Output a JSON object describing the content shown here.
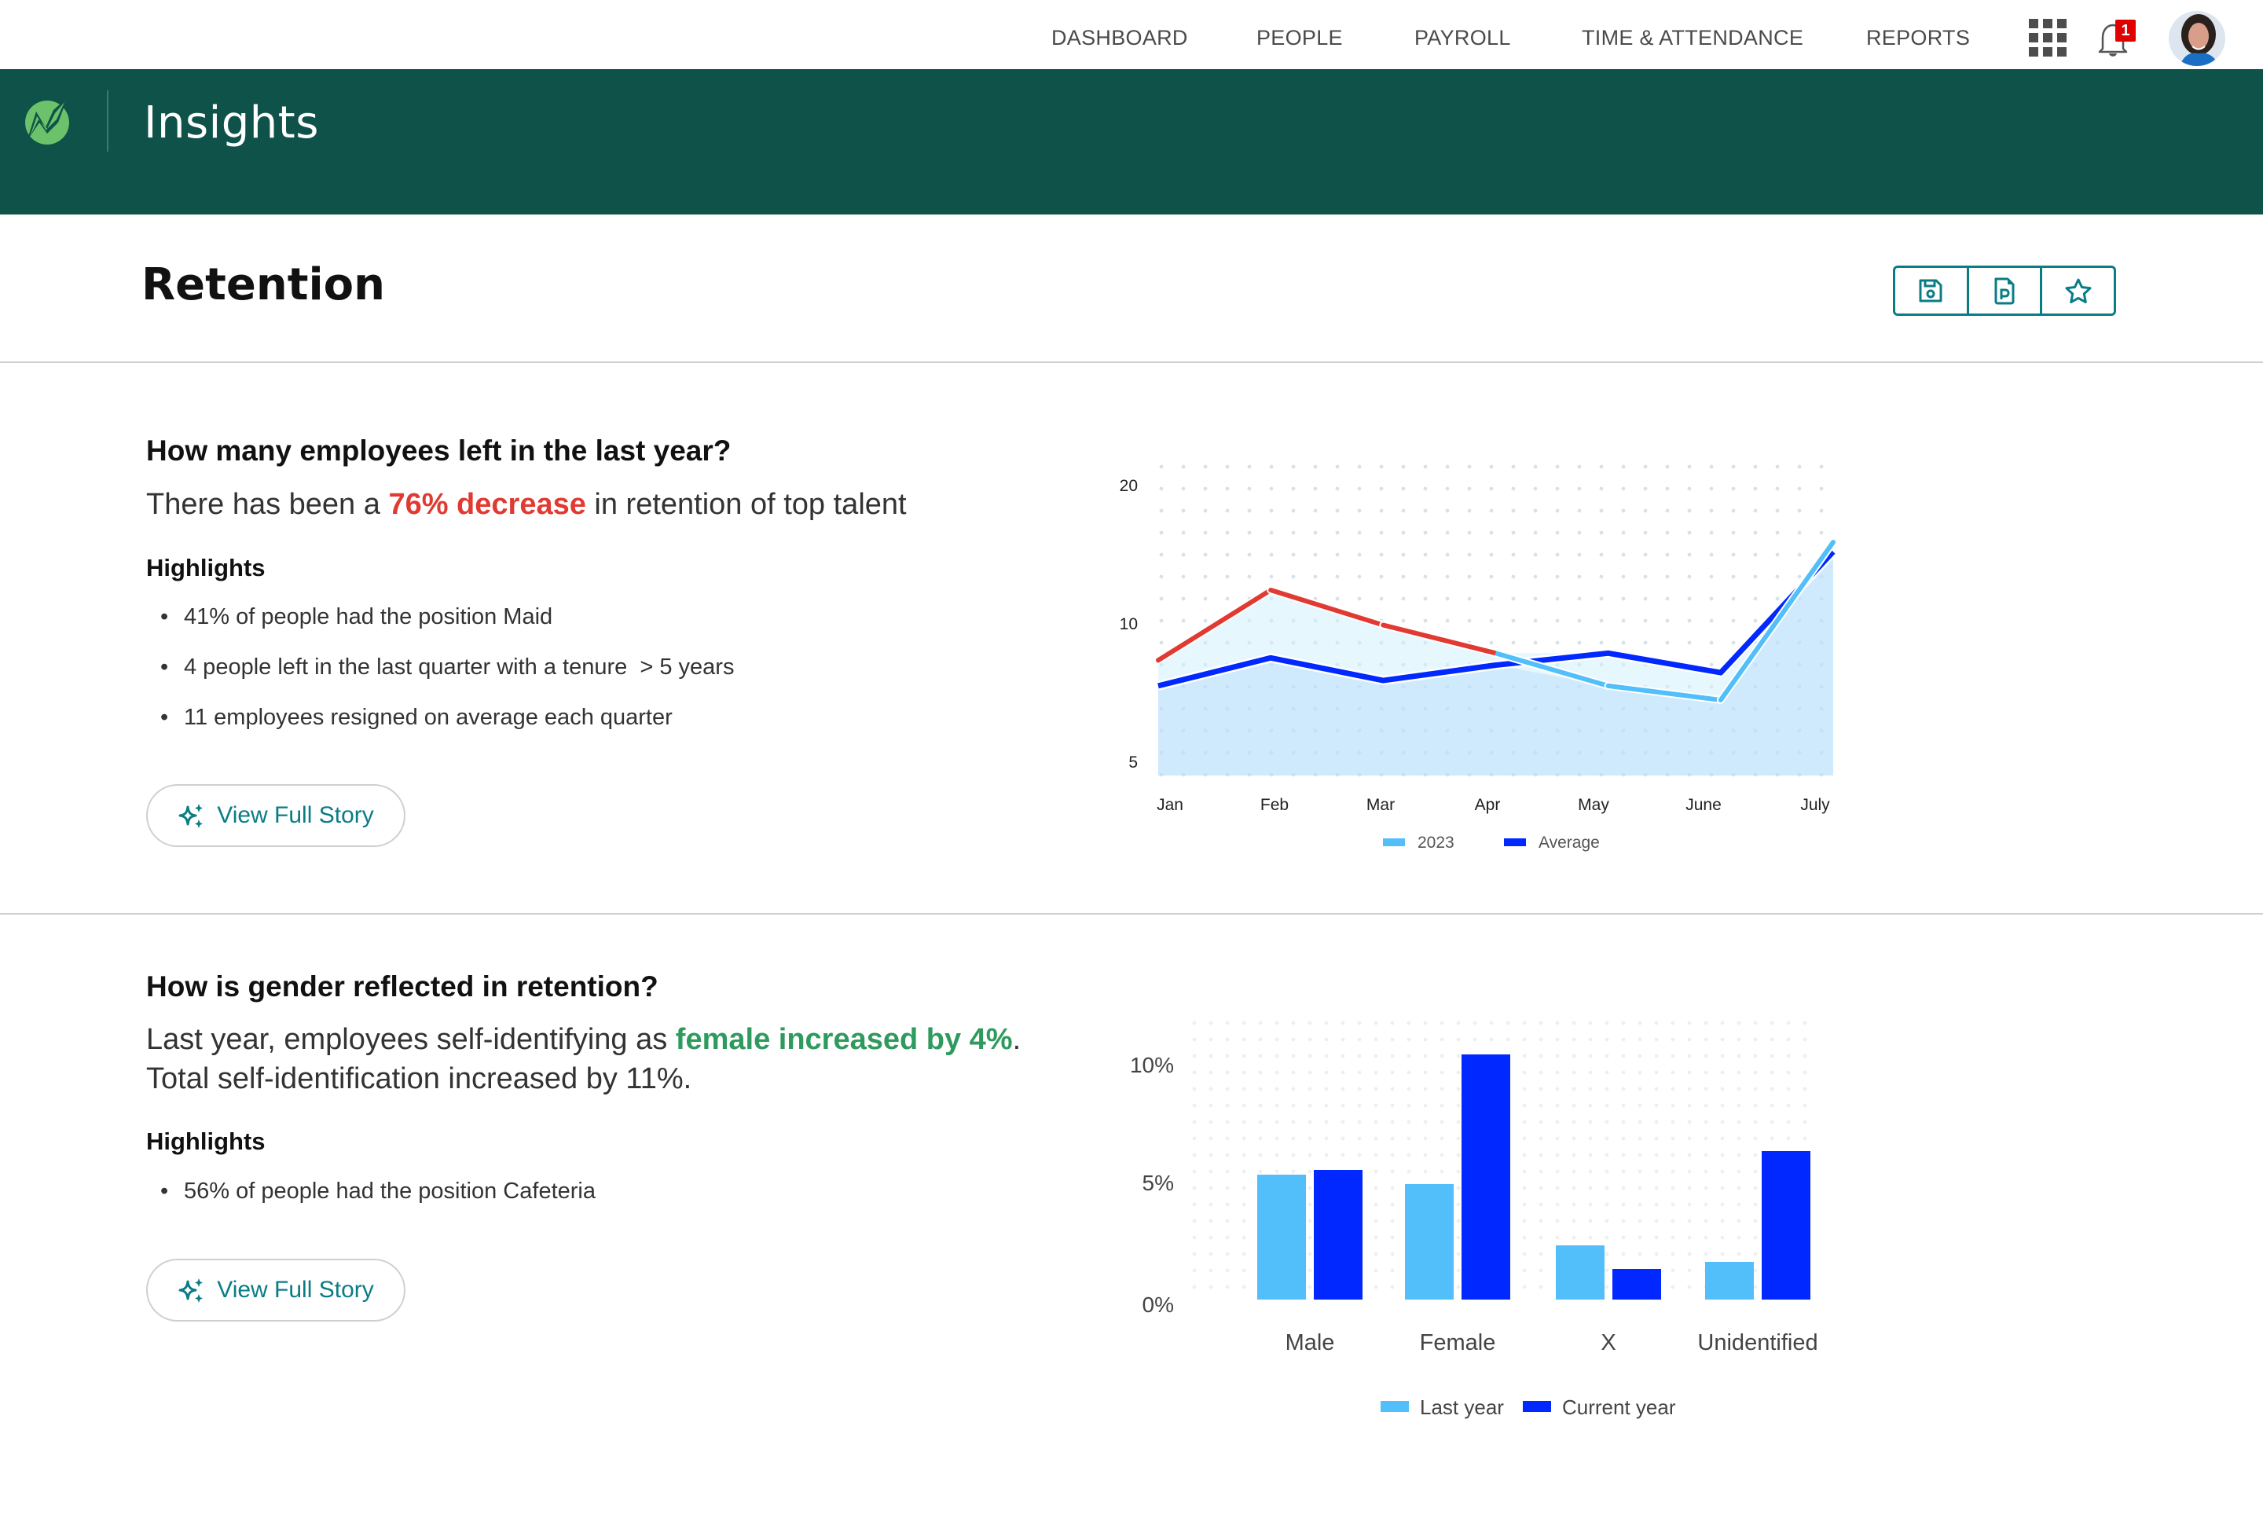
{
  "topnav": {
    "items": [
      "DASHBOARD",
      "PEOPLE",
      "PAYROLL",
      "TIME & ATTENDANCE",
      "REPORTS"
    ],
    "notification_count": "1",
    "icons": {
      "apps": "apps-grid-icon",
      "notifications": "bell-icon",
      "profile": "avatar"
    }
  },
  "banner": {
    "title": "Insights",
    "logo": "brand-logo"
  },
  "page": {
    "title": "Retention",
    "actions": [
      {
        "name": "save",
        "icon": "save-icon"
      },
      {
        "name": "export-pdf",
        "icon": "pdf-file-icon"
      },
      {
        "name": "favorite",
        "icon": "star-icon"
      }
    ]
  },
  "colors": {
    "banner": "#0e5249",
    "accent": "#0a7c86",
    "negative": "#e03a32",
    "positive": "#2f9a5e",
    "series_light": "#52bffa",
    "series_dark": "#0028ff"
  },
  "sections": [
    {
      "question": "How many employees left in the last year?",
      "summary_prefix": "There has been a ",
      "summary_highlight": "76% decrease",
      "summary_suffix": " in retention of top talent",
      "highlights_title": "Highlights",
      "highlights": [
        "41% of people had the position Maid",
        "4 people left in the last quarter with a tenure  > 5 years",
        "11 employees resigned on average each quarter"
      ],
      "button_label": "View Full Story"
    },
    {
      "question": "How is gender reflected in retention?",
      "summary_prefix": "Last year, employees self-identifying as ",
      "summary_highlight": "female increased by 4%",
      "summary_suffix": ".",
      "summary_line2": "Total self-identification increased by 11%.",
      "highlights_title": "Highlights",
      "highlights": [
        "56% of people had the position Cafeteria"
      ],
      "button_label": "View Full Story"
    }
  ],
  "chart_data": [
    {
      "type": "line",
      "title": "",
      "xlabel": "",
      "ylabel": "",
      "scale": "log",
      "ylim": [
        4.8,
        20
      ],
      "yticks": [
        5,
        10,
        20
      ],
      "ytick_labels": [
        "5",
        "10",
        "20"
      ],
      "categories": [
        "Jan",
        "Feb",
        "Mar",
        "Apr",
        "May",
        "June",
        "July"
      ],
      "grid": "dotted",
      "legend": "bottom-center",
      "series": [
        {
          "name": "2023",
          "values": [
            8.3,
            11.8,
            9.9,
            8.6,
            7.3,
            6.8,
            15.0
          ],
          "color": "#52bffa",
          "above_average_color": "#e03a32"
        },
        {
          "name": "Average",
          "values": [
            7.3,
            8.4,
            7.5,
            8.1,
            8.6,
            7.8,
            14.3
          ],
          "color": "#0028ff"
        }
      ]
    },
    {
      "type": "bar",
      "title": "",
      "xlabel": "",
      "ylabel": "",
      "ylim": [
        0,
        12
      ],
      "yticks": [
        0,
        5,
        10
      ],
      "ytick_labels": [
        "0%",
        "5%",
        "10%"
      ],
      "categories": [
        "Male",
        "Female",
        "X",
        "Unidentified"
      ],
      "grid": "dotted",
      "legend": "bottom-center",
      "series": [
        {
          "name": "Last year",
          "values": [
            5.3,
            4.9,
            2.3,
            1.6
          ],
          "color": "#52bffa"
        },
        {
          "name": "Current year",
          "values": [
            5.5,
            10.4,
            1.3,
            6.3
          ],
          "color": "#0028ff"
        }
      ]
    }
  ]
}
